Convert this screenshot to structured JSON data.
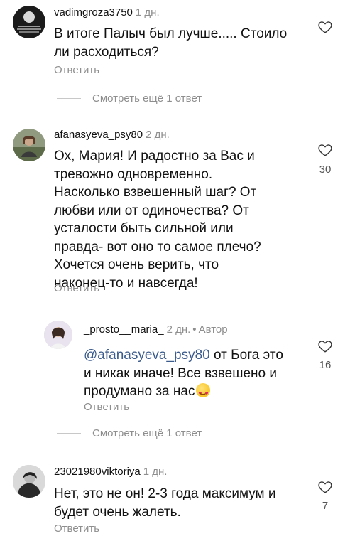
{
  "comments": [
    {
      "username": "vadimgroza3750",
      "time": "1 дн.",
      "text": "В итоге Палыч был лучше..... Стоило\nли расходиться?",
      "reply": "Ответить"
    },
    {
      "username": "afanasyeva_psy80",
      "time": "2 дн.",
      "text": "Ох, Мария! И радостно за Вас и\nтревожно одновременно.\nНасколько взвешенный шаг? От\nлюбви или от одиночества? От\nусталости быть сильной или\nправда-  вот оно то самое плечо?\nХочется очень верить, что\nнаконец-то и навсегда!",
      "reply": "Ответить",
      "likes": "30"
    },
    {
      "username": "_prosto__maria_",
      "time": "2 дн.",
      "author_badge": "Автор",
      "mention": "@afanasyeva_psy80",
      "text_line1": " от Бога это",
      "text_rest": "и никак иначе! Все взвешено и\nпродумано за нас",
      "reply": "Ответить",
      "likes": "16"
    },
    {
      "username": "23021980viktoriya",
      "time": "1 дн.",
      "text": "Нет, это не он! 2-3 года максимум и\nбудет очень жалеть.",
      "reply": "Ответить",
      "likes": "7"
    }
  ],
  "more_replies": [
    "Смотреть ещё 1 ответ",
    "Смотреть ещё 1 ответ"
  ],
  "colors": {
    "secondary_text": "#8e8e8e",
    "mention": "#3b5b8c",
    "divider": "#c8c8c8"
  },
  "icons": {
    "like": "heart-outline-icon",
    "emoji": "heart-eyes-emoji"
  }
}
